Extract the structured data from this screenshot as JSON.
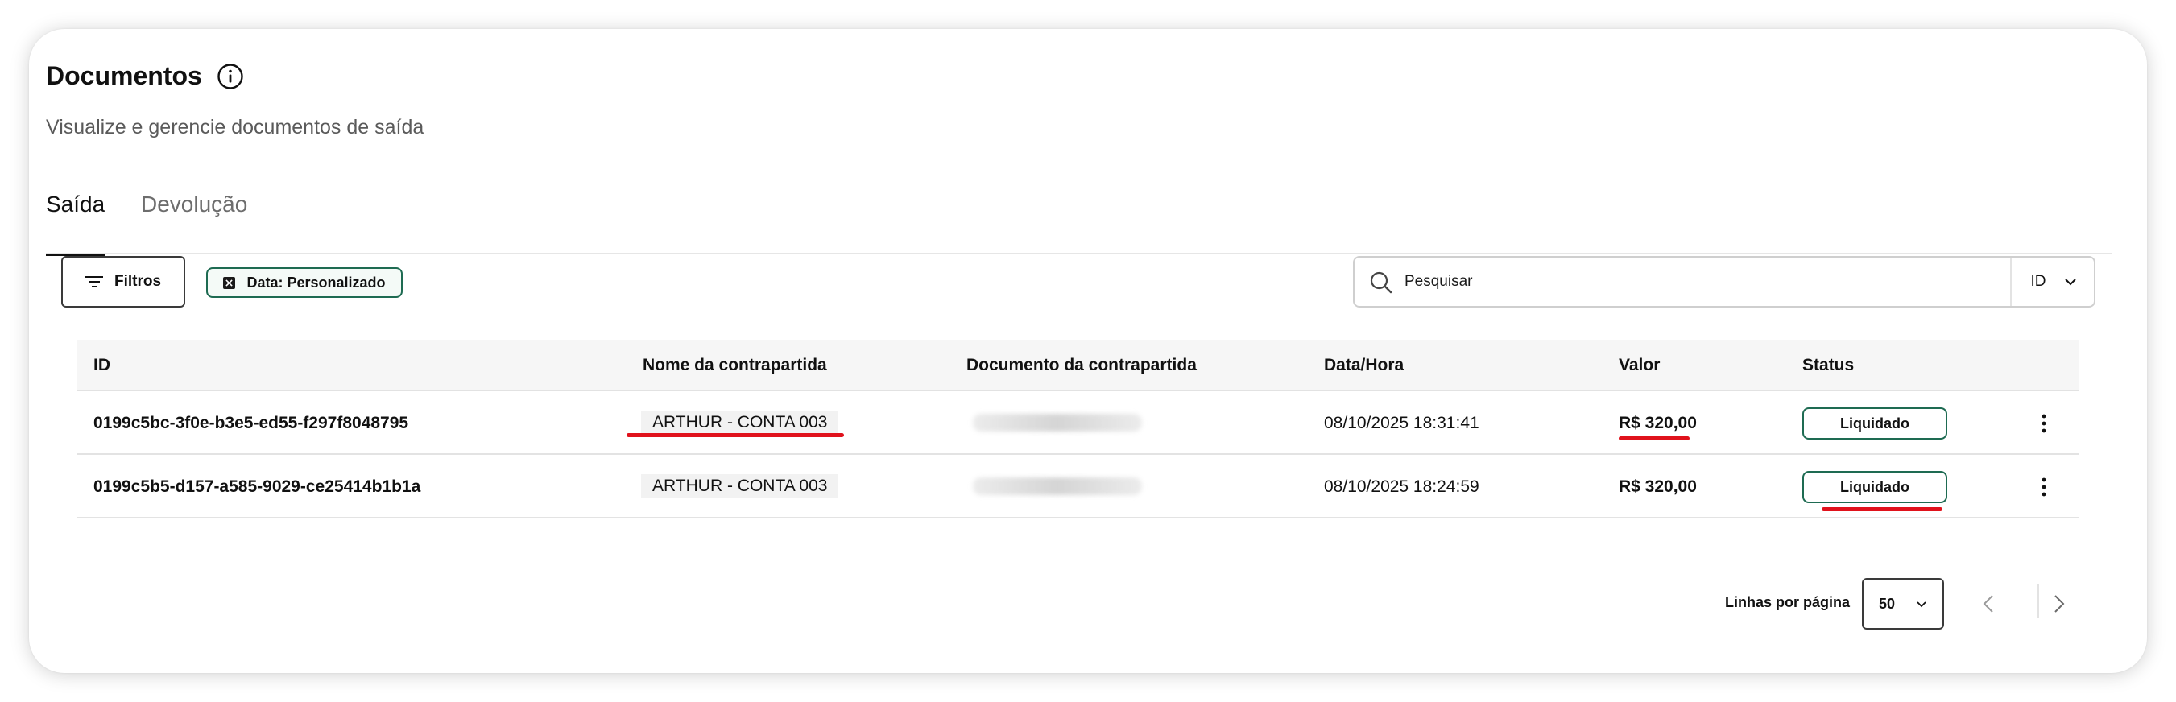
{
  "header": {
    "title": "Documentos",
    "subtitle": "Visualize e gerencie documentos de saída"
  },
  "tabs": [
    {
      "label": "Saída",
      "active": true
    },
    {
      "label": "Devolução",
      "active": false
    }
  ],
  "toolbar": {
    "filters_label": "Filtros",
    "chip_label": "Data: Personalizado",
    "search_placeholder": "Pesquisar",
    "search_field_value": "ID"
  },
  "table": {
    "columns": [
      "ID",
      "Nome da contrapartida",
      "Documento da contrapartida",
      "Data/Hora",
      "Valor",
      "Status"
    ],
    "rows": [
      {
        "id": "0199c5bc-3f0e-b3e5-ed55-f297f8048795",
        "name": "ARTHUR - CONTA 003",
        "datetime": "08/10/2025 18:31:41",
        "value": "R$ 320,00",
        "status": "Liquidado"
      },
      {
        "id": "0199c5b5-d157-a585-9029-ce25414b1b1a",
        "name": "ARTHUR - CONTA 003",
        "datetime": "08/10/2025 18:24:59",
        "value": "R$ 320,00",
        "status": "Liquidado"
      }
    ]
  },
  "pagination": {
    "rows_label": "Linhas por página",
    "rows_value": "50"
  },
  "colors": {
    "accent": "#1e6b52",
    "annotation": "#e0121c"
  }
}
